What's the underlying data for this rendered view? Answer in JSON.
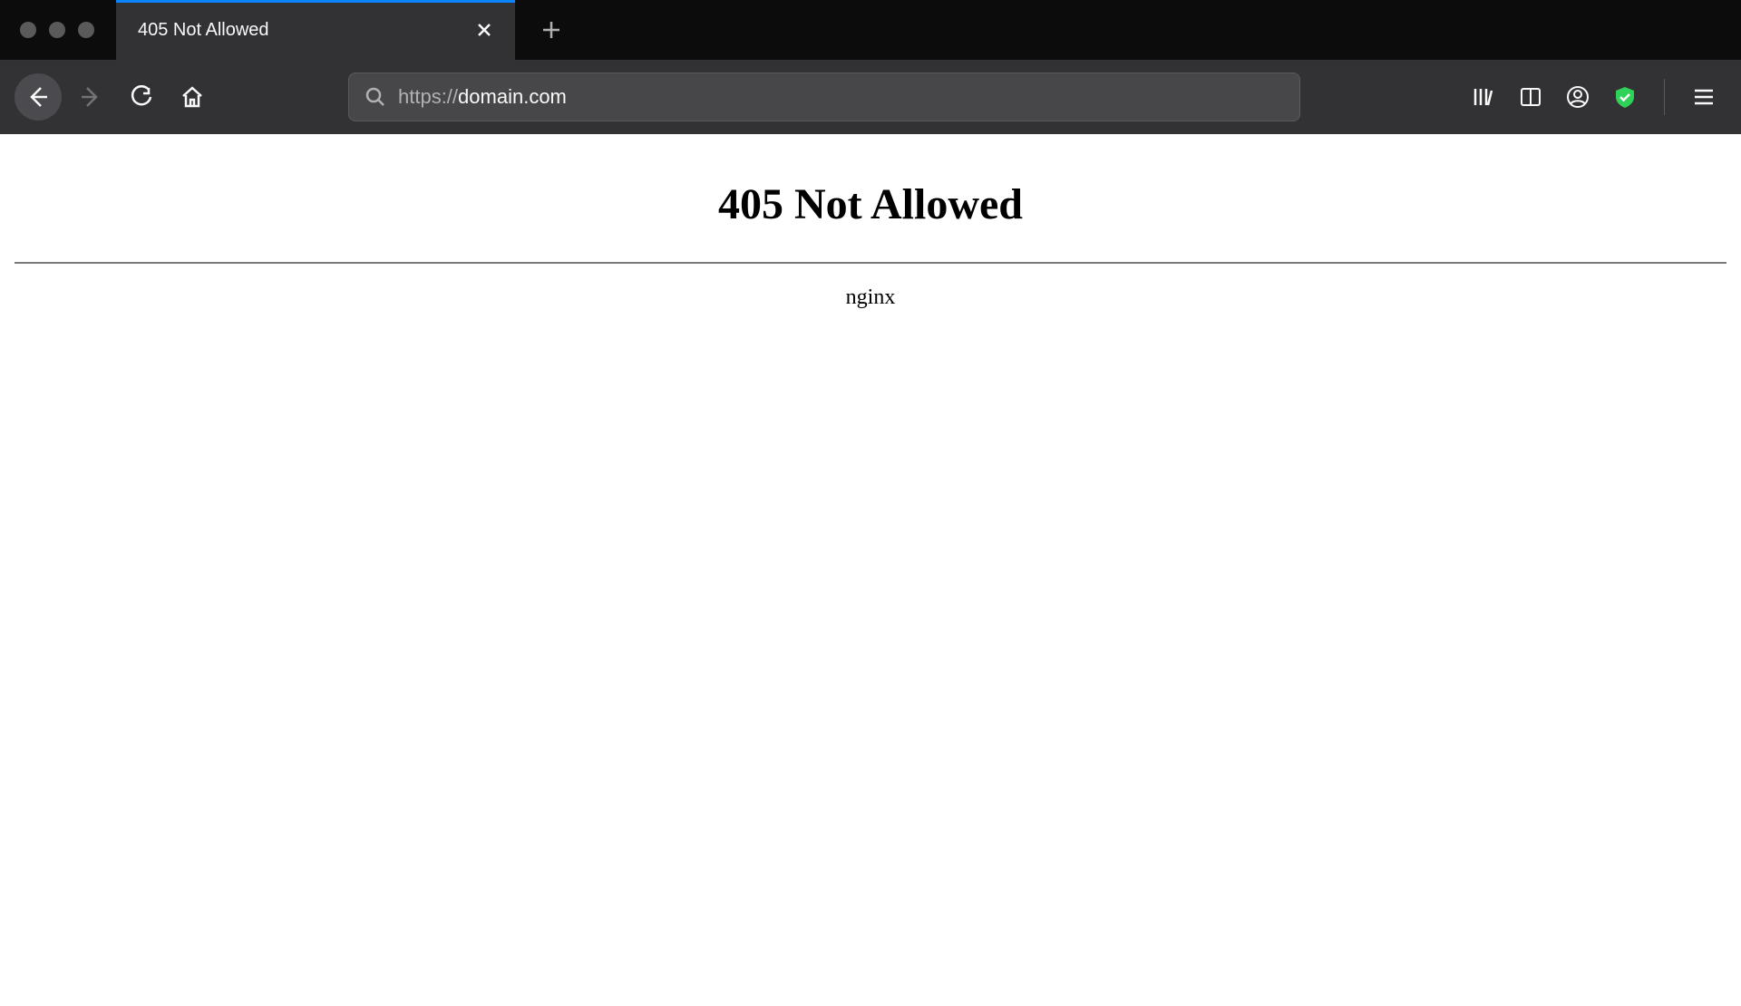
{
  "tab": {
    "title": "405 Not Allowed"
  },
  "address": {
    "protocol": "https://",
    "domain": "domain.com"
  },
  "page": {
    "heading": "405 Not Allowed",
    "server": "nginx"
  }
}
